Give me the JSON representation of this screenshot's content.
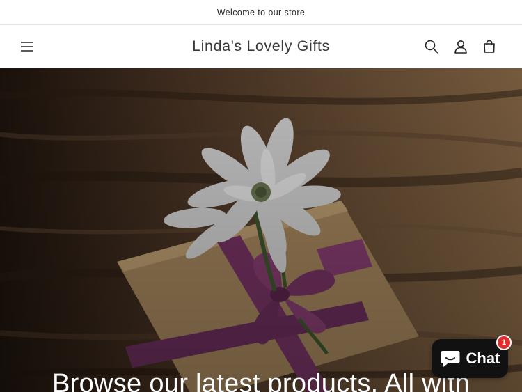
{
  "announcement": {
    "text": "Welcome to our store"
  },
  "header": {
    "brand": "Linda's Lovely Gifts",
    "icons": {
      "menu": "hamburger-menu-icon",
      "search": "search-icon",
      "account": "account-icon",
      "cart": "cart-icon"
    }
  },
  "hero": {
    "heading": "Browse our latest products. All with"
  },
  "chat": {
    "label": "Chat",
    "badge": "1",
    "icon": "chat-bubble-icon"
  },
  "colors": {
    "text": "#121212",
    "chat_bg": "#111111",
    "badge": "#e02c2c",
    "ribbon": "#8a3f73"
  }
}
